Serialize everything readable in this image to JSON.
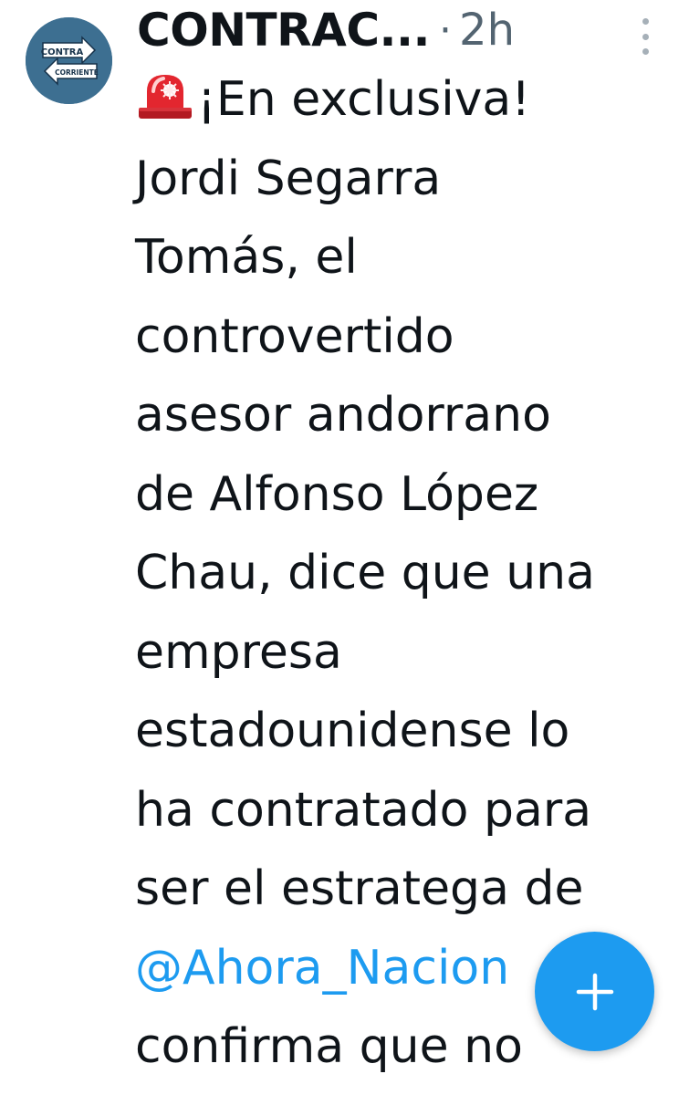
{
  "tweet": {
    "avatar_icon": "contracorriente-logo-icon",
    "avatar_logo_text_top": "CONTRA",
    "avatar_logo_text_bottom": "CORRIENTE",
    "author": "CONTRAC...",
    "separator": "·",
    "time": "2h",
    "more_icon": "vertical-dots-icon",
    "siren_icon": "police-siren-emoji-icon",
    "lines": [
      "¡En exclusiva!",
      "Jordi Segarra",
      "Tomás, el",
      "controvertido",
      "asesor andorrano",
      "de Alfonso López",
      "Chau, dice que una",
      "empresa",
      "estadounidense lo",
      "ha contratado para",
      "ser el estratega de"
    ],
    "mention": "@Ahora_Nacion",
    "last_line": "confirma que no"
  },
  "fab": {
    "icon": "plus-icon"
  },
  "colors": {
    "accent": "#1d9bf0",
    "text": "#0f1419",
    "secondary": "#536471"
  }
}
